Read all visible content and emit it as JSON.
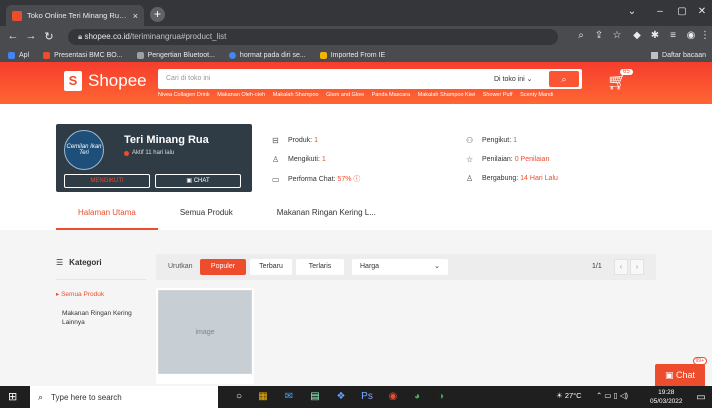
{
  "browser": {
    "tab_title": "Toko Online Teri Minang Rua | Sh",
    "tab_close": "×",
    "new_tab": "+",
    "url_host": "shopee.co.id",
    "url_path": "/teriminangrua#product_list",
    "bookmarks": [
      {
        "label": "Apl",
        "color": "#4285f4"
      },
      {
        "label": "Presentasi BMC BO...",
        "color": "#ee4d2d"
      },
      {
        "label": "Pengertian Bluetoot...",
        "color": "#9aa0a6"
      },
      {
        "label": "hormat pada diri se...",
        "color": "#4285f4"
      },
      {
        "label": "Imported From IE",
        "color": "#f4b400"
      }
    ],
    "bookmark_right": "Daftar bacaan"
  },
  "header": {
    "logo_text": "Shopee",
    "logo_glyph": "S",
    "search_placeholder": "Cari di toko ini",
    "search_scope": "Di toko ini ⌄",
    "search_icon": "search-icon",
    "cart_count": "65",
    "keywords": [
      "Nivea Collagen Drink",
      "Makanan Oleh-oleh",
      "Makalah Shampoo",
      "Glam and Glow",
      "Panda Mascara",
      "Makalah Shampoo Kiwi",
      "Shower Puff",
      "Scenty Mandi"
    ]
  },
  "shop": {
    "name": "Teri Minang Rua",
    "active": "Aktif 11 hari lalu",
    "avatar_text": "Cemilan Ikan Teri",
    "follow_label": "MENGIKUTI",
    "chat_label": "CHAT",
    "stats": [
      {
        "label": "Produk:",
        "value": "1"
      },
      {
        "label": "Mengikuti:",
        "value": "1"
      },
      {
        "label": "Performa Chat:",
        "value": "57% ⓘ"
      },
      {
        "label": "Pengikut:",
        "value": "1"
      },
      {
        "label": "Penilaian:",
        "value": "0 Penilaian"
      },
      {
        "label": "Bergabung:",
        "value": "14 Hari Lalu"
      }
    ],
    "tabs": [
      "Halaman Utama",
      "Semua Produk",
      "Makanan Ringan Kering L..."
    ]
  },
  "sidebar": {
    "heading": "Kategori",
    "items": [
      "Semua Produk",
      "Makanan Ringan Kering Lainnya"
    ]
  },
  "sortbar": {
    "label": "Urutkan",
    "options": [
      "Populer",
      "Terbaru",
      "Terlaris"
    ],
    "price_label": "Harga",
    "page": "1/1"
  },
  "chat_float": {
    "label": "Chat",
    "count": "99+"
  },
  "taskbar": {
    "search_placeholder": "Type here to search",
    "temperature": "27°C",
    "time": "19:28",
    "date": "05/03/2022"
  },
  "colors": {
    "brand": "#ee4d2d",
    "header_gradient": [
      "#f53d2d",
      "#ff6633"
    ]
  }
}
